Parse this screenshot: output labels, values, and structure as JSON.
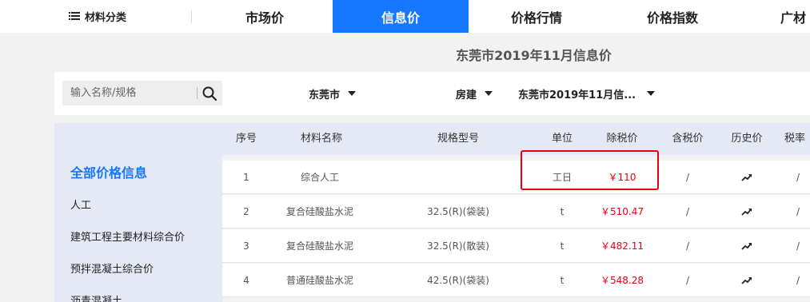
{
  "nav": {
    "category_label": "材料分类",
    "tabs": [
      {
        "label": "市场价"
      },
      {
        "label": "信息价"
      },
      {
        "label": "价格行情"
      },
      {
        "label": "价格指数"
      },
      {
        "label": "广材"
      }
    ],
    "active_tab": "信息价"
  },
  "page_title": "东莞市2019年11月信息价",
  "filters": {
    "search_placeholder": "输入名称/规格",
    "city": "东莞市",
    "category": "房建",
    "period": "东莞市2019年11月信..."
  },
  "sidebar": {
    "items": [
      {
        "label": "全部价格信息"
      },
      {
        "label": "人工"
      },
      {
        "label": "建筑工程主要材料综合价"
      },
      {
        "label": "预拌混凝土综合价"
      },
      {
        "label": "沥青混凝土"
      }
    ]
  },
  "table": {
    "headers": [
      "序号",
      "材料名称",
      "规格型号",
      "单位",
      "除税价",
      "含税价",
      "历史价",
      "税率"
    ],
    "rows": [
      {
        "no": "1",
        "name": "综合人工",
        "spec": "",
        "unit": "工日",
        "price": "￥110",
        "tax_price": "/",
        "tax_rate": "/"
      },
      {
        "no": "2",
        "name": "复合硅酸盐水泥",
        "spec": "32.5(R)(袋装)",
        "unit": "t",
        "price": "￥510.47",
        "tax_price": "/",
        "tax_rate": "/"
      },
      {
        "no": "3",
        "name": "复合硅酸盐水泥",
        "spec": "32.5(R)(散装)",
        "unit": "t",
        "price": "￥482.11",
        "tax_price": "/",
        "tax_rate": "/"
      },
      {
        "no": "4",
        "name": "普通硅酸盐水泥",
        "spec": "42.5(R)(袋装)",
        "unit": "t",
        "price": "￥548.28",
        "tax_price": "/",
        "tax_rate": "/"
      }
    ]
  },
  "colors": {
    "accent": "#1677ff",
    "price": "#e60012",
    "highlight_border": "#e60012",
    "sidebar_bg": "#e4e9f5"
  },
  "icons": {
    "menu": "menu-icon",
    "search": "search-icon",
    "dropdown": "caret-down-icon",
    "history": "trend-up-icon"
  }
}
